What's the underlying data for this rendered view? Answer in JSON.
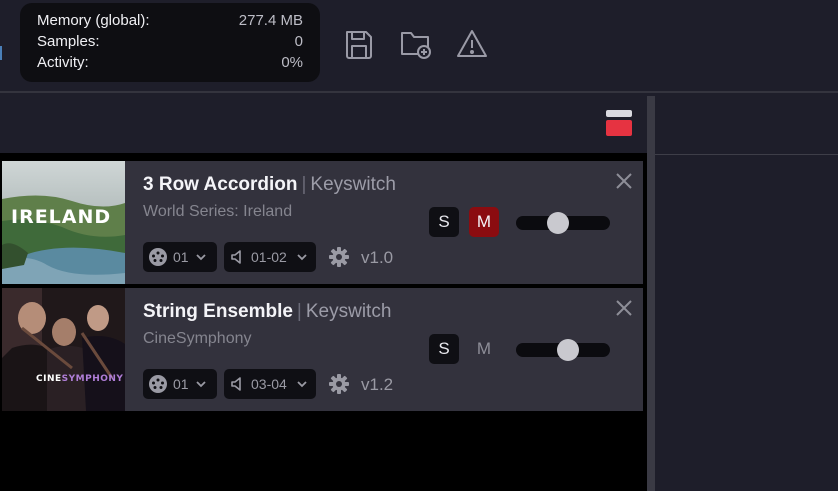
{
  "stats": {
    "memory_label": "Memory (global):",
    "memory_value": "277.4 MB",
    "samples_label": "Samples:",
    "samples_value": "0",
    "activity_label": "Activity:",
    "activity_value": "0%"
  },
  "toolbar": {
    "icons": [
      "save-icon",
      "folder-add-icon",
      "warning-icon"
    ]
  },
  "instruments": [
    {
      "name": "3 Row Accordion",
      "separator": "|",
      "mode": "Keyswitch",
      "library": "World Series: Ireland",
      "image_label": "IRELAND",
      "solo_label": "S",
      "mute_label": "M",
      "mute_active": true,
      "volume_level": 0.45,
      "midi_channel": "01",
      "audio_output": "01-02",
      "version": "v1.0"
    },
    {
      "name": "String Ensemble",
      "separator": "|",
      "mode": "Keyswitch",
      "library": "CineSymphony",
      "image_label_part1": "CINE",
      "image_label_part2": "SYMPHONY",
      "solo_label": "S",
      "mute_label": "M",
      "mute_active": false,
      "volume_level": 0.55,
      "midi_channel": "01",
      "audio_output": "03-04",
      "version": "v1.2"
    }
  ],
  "colors": {
    "background": "#1e1e2a",
    "card": "#33323d",
    "mute_active": "#8b0c10",
    "accent_red": "#e63341"
  }
}
